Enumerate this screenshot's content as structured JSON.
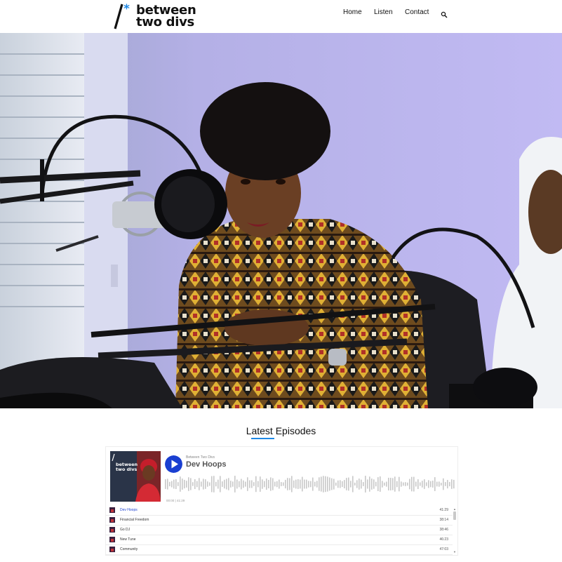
{
  "site": {
    "logo_line1": "between",
    "logo_line2": "two divs",
    "logo_symbol": "*",
    "accent_color": "#1e88e5"
  },
  "nav": {
    "items": [
      {
        "label": "Home"
      },
      {
        "label": "Listen"
      },
      {
        "label": "Contact"
      }
    ],
    "search_icon": "search-icon"
  },
  "section": {
    "title": "Latest Episodes"
  },
  "player": {
    "cover_title_line1": "between",
    "cover_title_line2": "two divs",
    "podcast_name": "Between Two Divs",
    "current_episode": "Dev Hoops",
    "elapsed": "00:00",
    "duration": "41:29",
    "play_color": "#1a3fd1",
    "episodes": [
      {
        "title": "Dev Hoops",
        "duration": "41:29",
        "active": true
      },
      {
        "title": "Financial Freedom",
        "duration": "38:14"
      },
      {
        "title": "Go DJ",
        "duration": "38:46"
      },
      {
        "title": "New Tune",
        "duration": "46:23"
      },
      {
        "title": "Community",
        "duration": "47:03"
      }
    ]
  }
}
